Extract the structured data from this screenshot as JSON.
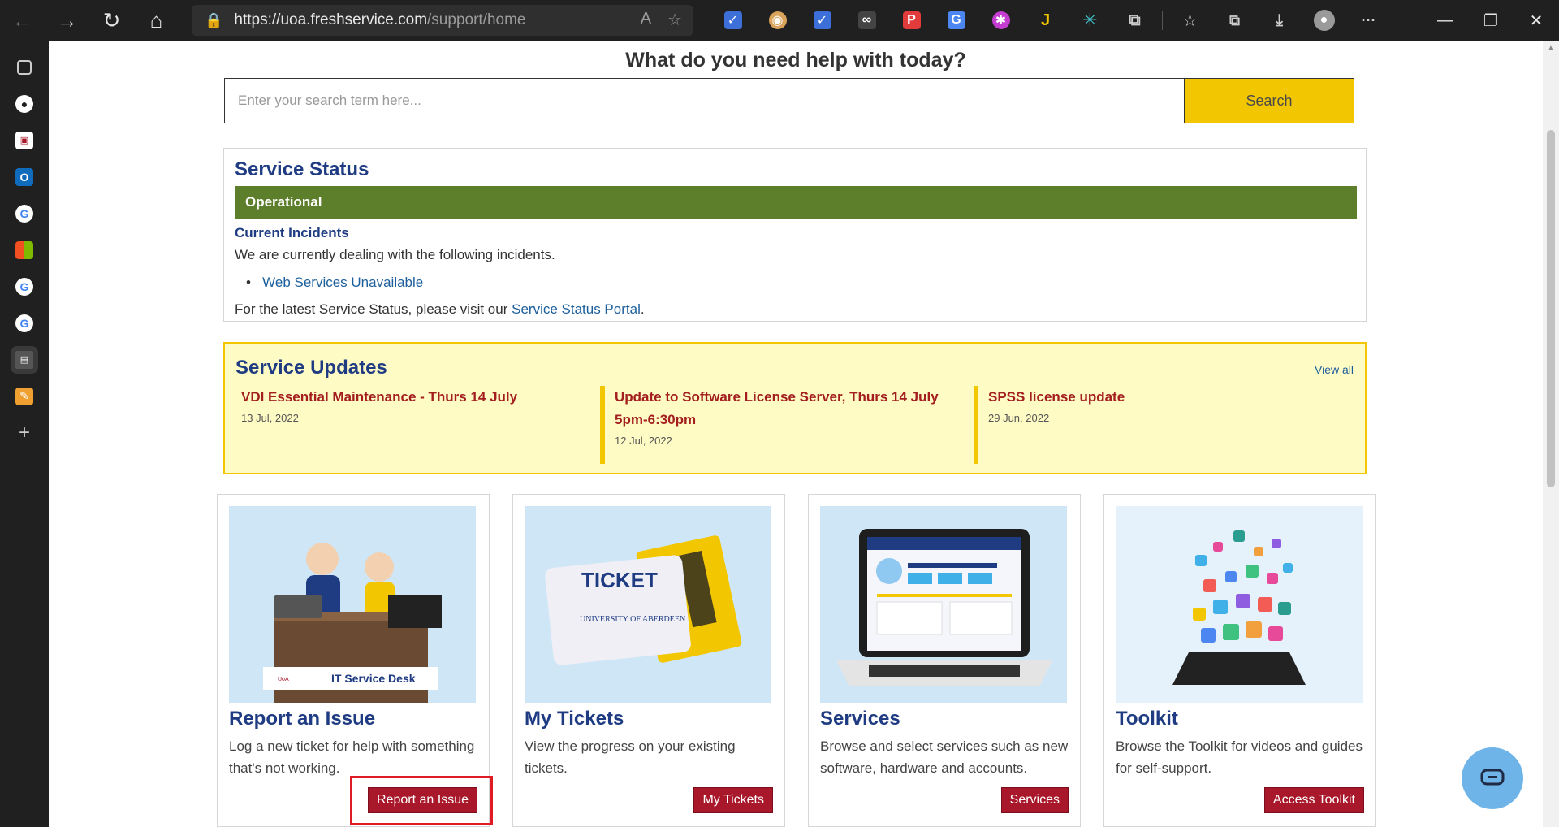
{
  "browser": {
    "url_host": "https://uoa.freshservice.com",
    "url_path": "/support/home",
    "back_icon": "←",
    "forward_icon": "→",
    "refresh_icon": "↻",
    "home_icon": "⌂",
    "more_icon": "···",
    "window_controls": [
      "—",
      "❐",
      "✕"
    ]
  },
  "extensions": [
    "bookmark",
    "reader",
    "bookmark-2",
    "glasses",
    "pdf",
    "translate",
    "pinwheel",
    "J",
    "asterisk",
    "puzzle",
    "favorites",
    "collections",
    "download",
    "profile",
    "more"
  ],
  "sidebar": {
    "items": [
      "tabs",
      "github",
      "app-3",
      "outlook",
      "google-1",
      "microsoft",
      "google-2",
      "google-3",
      "uoa-active",
      "notes",
      "add"
    ]
  },
  "page": {
    "help_title": "What do you need help with today?",
    "search": {
      "placeholder": "Enter your search term here...",
      "button": "Search"
    },
    "service_status": {
      "title": "Service Status",
      "status": "Operational",
      "status_color": "#5d7e2a",
      "incidents_title": "Current Incidents",
      "incidents_text": "We are currently dealing with the following incidents.",
      "incidents": [
        "Web Services Unavailable"
      ],
      "portal_prefix": "For the latest Service Status, please visit our ",
      "portal_link": "Service Status Portal",
      "portal_suffix": "."
    },
    "service_updates": {
      "title": "Service Updates",
      "view_all": "View all",
      "items": [
        {
          "title": "VDI Essential Maintenance - Thurs 14 July",
          "date": "13 Jul, 2022"
        },
        {
          "title": "Update to Software License Server, Thurs 14 July 5pm-6:30pm",
          "date": "12 Jul, 2022"
        },
        {
          "title": "SPSS license update",
          "date": "29 Jun, 2022"
        }
      ]
    },
    "cards": [
      {
        "title": "Report an Issue",
        "desc": "Log a new ticket for help with something that's not working.",
        "button": "Report an Issue",
        "image_label": "IT Service Desk"
      },
      {
        "title": "My Tickets",
        "desc": "View the progress on your existing tickets.",
        "button": "My Tickets",
        "image_label": "TICKET",
        "image_sublabel": "UNIVERSITY OF ABERDEEN"
      },
      {
        "title": "Services",
        "desc": "Browse and select services such as new software, hardware and accounts.",
        "button": "Services"
      },
      {
        "title": "Toolkit",
        "desc": "Browse the Toolkit for videos and guides for self-support.",
        "button": "Access Toolkit"
      }
    ],
    "colors": {
      "accent_blue": "#1f3c83",
      "search_yellow": "#f2c600",
      "button_red": "#a8172a",
      "highlight_red": "#e01b24"
    }
  }
}
